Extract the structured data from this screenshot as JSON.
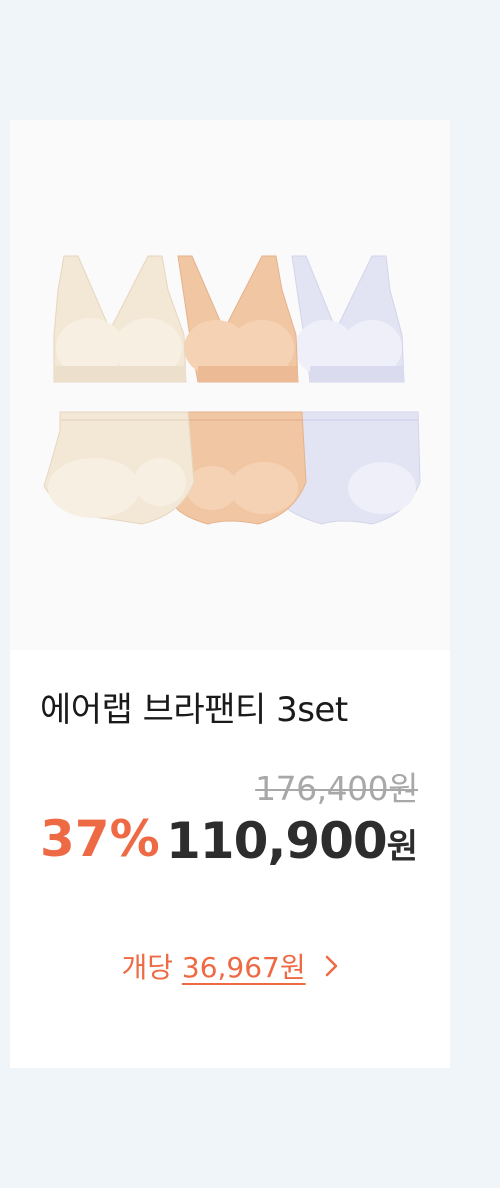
{
  "product": {
    "title": "에어랩 브라팬티 3set",
    "original_price": "176,400원",
    "discount": "37%",
    "sale_price": "110,900",
    "sale_currency": "원",
    "unit_prefix": "개당",
    "unit_amount": "36,967원",
    "image_colors": [
      "#f3e7d6",
      "#f1c6a3",
      "#e3e4f3"
    ],
    "product_image_icon": "bra-panty-set-image",
    "chevron_icon": "chevron-right-icon"
  },
  "colors": {
    "accent": "#ee6a45",
    "page_bg": "#f0f5fa",
    "card_bg": "#ffffff",
    "image_bg": "#fafafa"
  }
}
